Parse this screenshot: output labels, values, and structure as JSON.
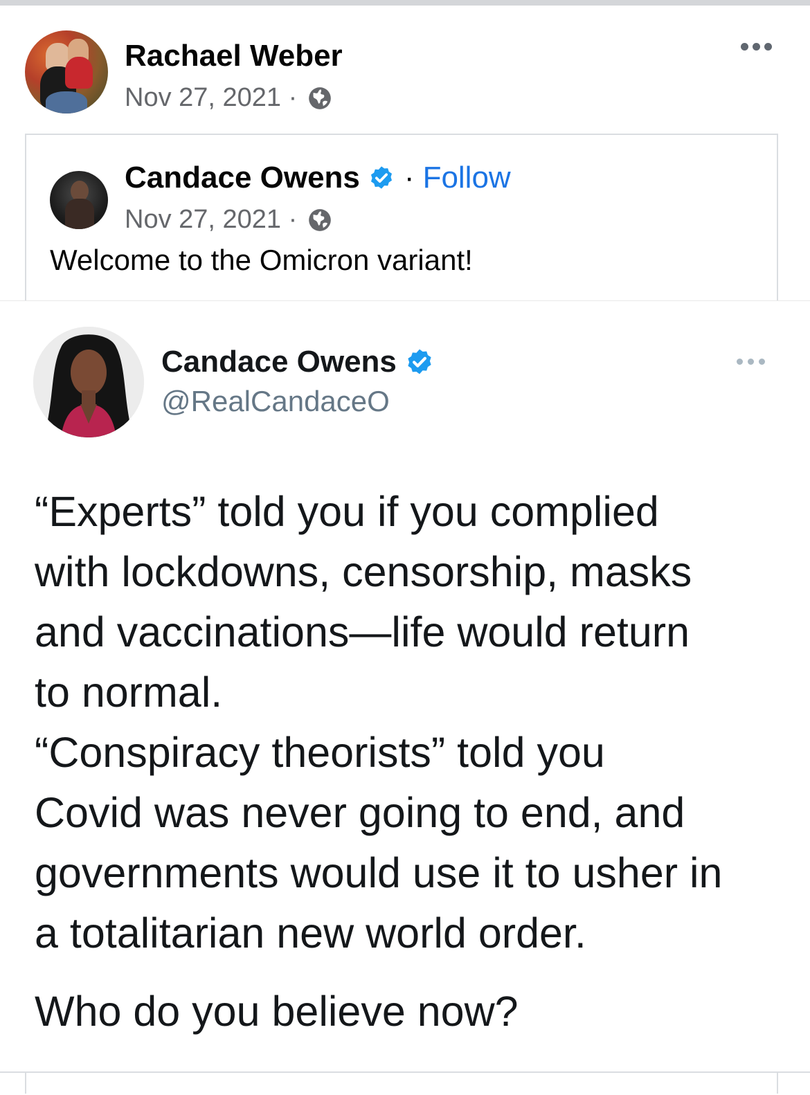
{
  "post": {
    "author": "Rachael Weber",
    "date": "Nov 27, 2021 ·",
    "privacy_icon": "globe-icon",
    "menu_icon": "more-options-icon"
  },
  "shared_post": {
    "author": "Candace Owens",
    "verified_icon": "verified-badge-icon",
    "separator": "·",
    "follow_label": "Follow",
    "date": "Nov 27, 2021 ·",
    "privacy_icon": "globe-icon",
    "text": "Welcome to the Omicron variant!"
  },
  "tweet": {
    "name": "Candace Owens",
    "handle": "@RealCandaceO",
    "verified_icon": "verified-badge-icon",
    "menu_icon": "more-options-icon",
    "lines": [
      "“Experts” told you if you complied",
      "with lockdowns, censorship, masks",
      "and vaccinations—life would return",
      "to normal.",
      "“Conspiracy theorists” told you",
      "Covid was never going to end, and",
      "governments would use it to usher in",
      "a totalitarian new world order."
    ],
    "question": "Who do you believe now?"
  },
  "colors": {
    "link": "#1b74e4",
    "verified": "#1d9bf0",
    "meta_text": "#65676b",
    "handle_text": "#657786"
  }
}
